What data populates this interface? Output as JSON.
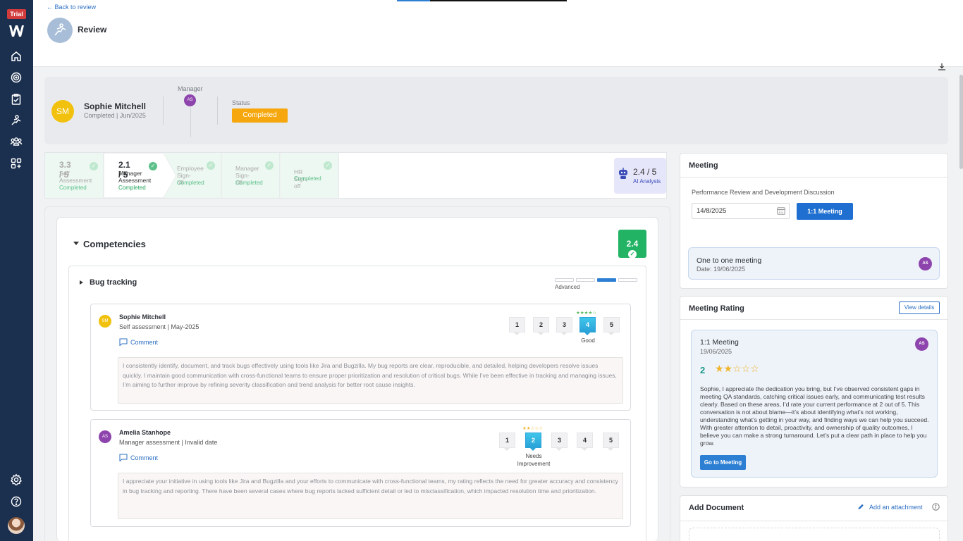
{
  "sidebar": {
    "trial_badge": "Trial",
    "nav": [
      "home-icon",
      "target-icon",
      "clipboard-check-icon",
      "review-icon",
      "team-icon",
      "apps-add-icon"
    ],
    "bottom": [
      "settings-icon",
      "help-icon"
    ]
  },
  "header": {
    "back_link": "Back to review",
    "title": "Review"
  },
  "profile": {
    "initials": "SM",
    "name": "Sophie Mitchell",
    "sub": "Completed | Jun/2025",
    "manager_label": "Manager",
    "manager_initials": "AS",
    "status_label": "Status",
    "status_value": "Completed",
    "status_color": "#f5a70d"
  },
  "stepper": {
    "steps": [
      {
        "score": "3.3 / 5",
        "label1": "Self",
        "label2": "Assessment",
        "status": "Completed"
      },
      {
        "score": "2.1 / 5",
        "label1": "Manager",
        "label2": "Assessment",
        "status": "Completed"
      },
      {
        "label1": "Employee",
        "label2": "Sign-off",
        "status": "Completed"
      },
      {
        "label1": "Manager",
        "label2": "Sign-off",
        "status": "Completed"
      },
      {
        "label1": "HR Sign-off",
        "status": "Completed"
      }
    ],
    "ai_score": "2.4 / 5",
    "ai_label": "AI Analysis"
  },
  "competencies": {
    "title": "Competencies",
    "score": "2.4",
    "skill": {
      "name": "Bug tracking",
      "level_label": "Advanced",
      "level_active": 3,
      "level_total": 4
    },
    "assessments": [
      {
        "initials": "SM",
        "avatar_color": "#f2c10e",
        "name": "Sophie Mitchell",
        "sub": "Self assessment | May-2025",
        "comment_label": "Comment",
        "rating": 4,
        "rating_word": "Good",
        "stars": "★★★★☆",
        "text": "I consistently identify, document, and track bugs effectively using tools like Jira and Bugzilla. My bug reports are clear, reproducible, and detailed, helping developers resolve issues quickly. I maintain good communication with cross-functional teams to ensure proper prioritization and resolution of critical bugs. While I’ve been effective in tracking and managing issues, I’m aiming to further improve by refining severity classification and trend analysis for better root cause insights."
      },
      {
        "initials": "AS",
        "avatar_color": "#8e44ad",
        "name": "Amelia Stanhope",
        "sub": "Manager assessment | Invalid date",
        "comment_label": "Comment",
        "rating": 2,
        "rating_word_1": "Needs",
        "rating_word_2": "Improvement",
        "stars": "★★☆☆☆",
        "text": "I appreciate your initiative in using tools like Jira and Bugzilla and your efforts to communicate with cross-functional teams, my rating reflects the need for greater accuracy and consistency in bug tracking and reporting. There have been several cases where bug reports lacked sufficient detail or led to misclassification, which impacted resolution time and prioritization."
      }
    ],
    "rating_options": [
      "1",
      "2",
      "3",
      "4",
      "5"
    ]
  },
  "meeting": {
    "title": "Meeting",
    "description": "Performance Review and Development Discussion",
    "date_value": "14/8/2025",
    "button": "1:1 Meeting",
    "card_title": "One to one meeting",
    "card_date": "Date: 19/06/2025",
    "card_initials": "AS"
  },
  "meeting_rating": {
    "title": "Meeting Rating",
    "view_button": "View details",
    "card_title": "1:1 Meeting",
    "card_date": "19/06/2025",
    "card_initials": "AS",
    "rating_number": "2",
    "stars": "★★☆☆☆",
    "text": "Sophie, I appreciate the dedication you bring, but I’ve observed consistent gaps in meeting QA standards, catching critical issues early, and communicating test results clearly. Based on these areas, I’d rate your current performance at 2 out of 5. This conversation is not about blame—it’s about identifying what’s not working, understanding what’s getting in your way, and finding ways we can help you succeed. With greater attention to detail, proactivity, and ownership of quality outcomes, I believe you can make a strong turnaround. Let’s put a clear path in place to help you grow.",
    "go_button": "Go to Meeting"
  },
  "documents": {
    "title": "Add Document",
    "attach_label": "Add an attachment"
  },
  "colors": {
    "sidebar": "#1b2f4e",
    "accent": "#1f6fd1",
    "success": "#22b364",
    "star": "#f0b429"
  }
}
